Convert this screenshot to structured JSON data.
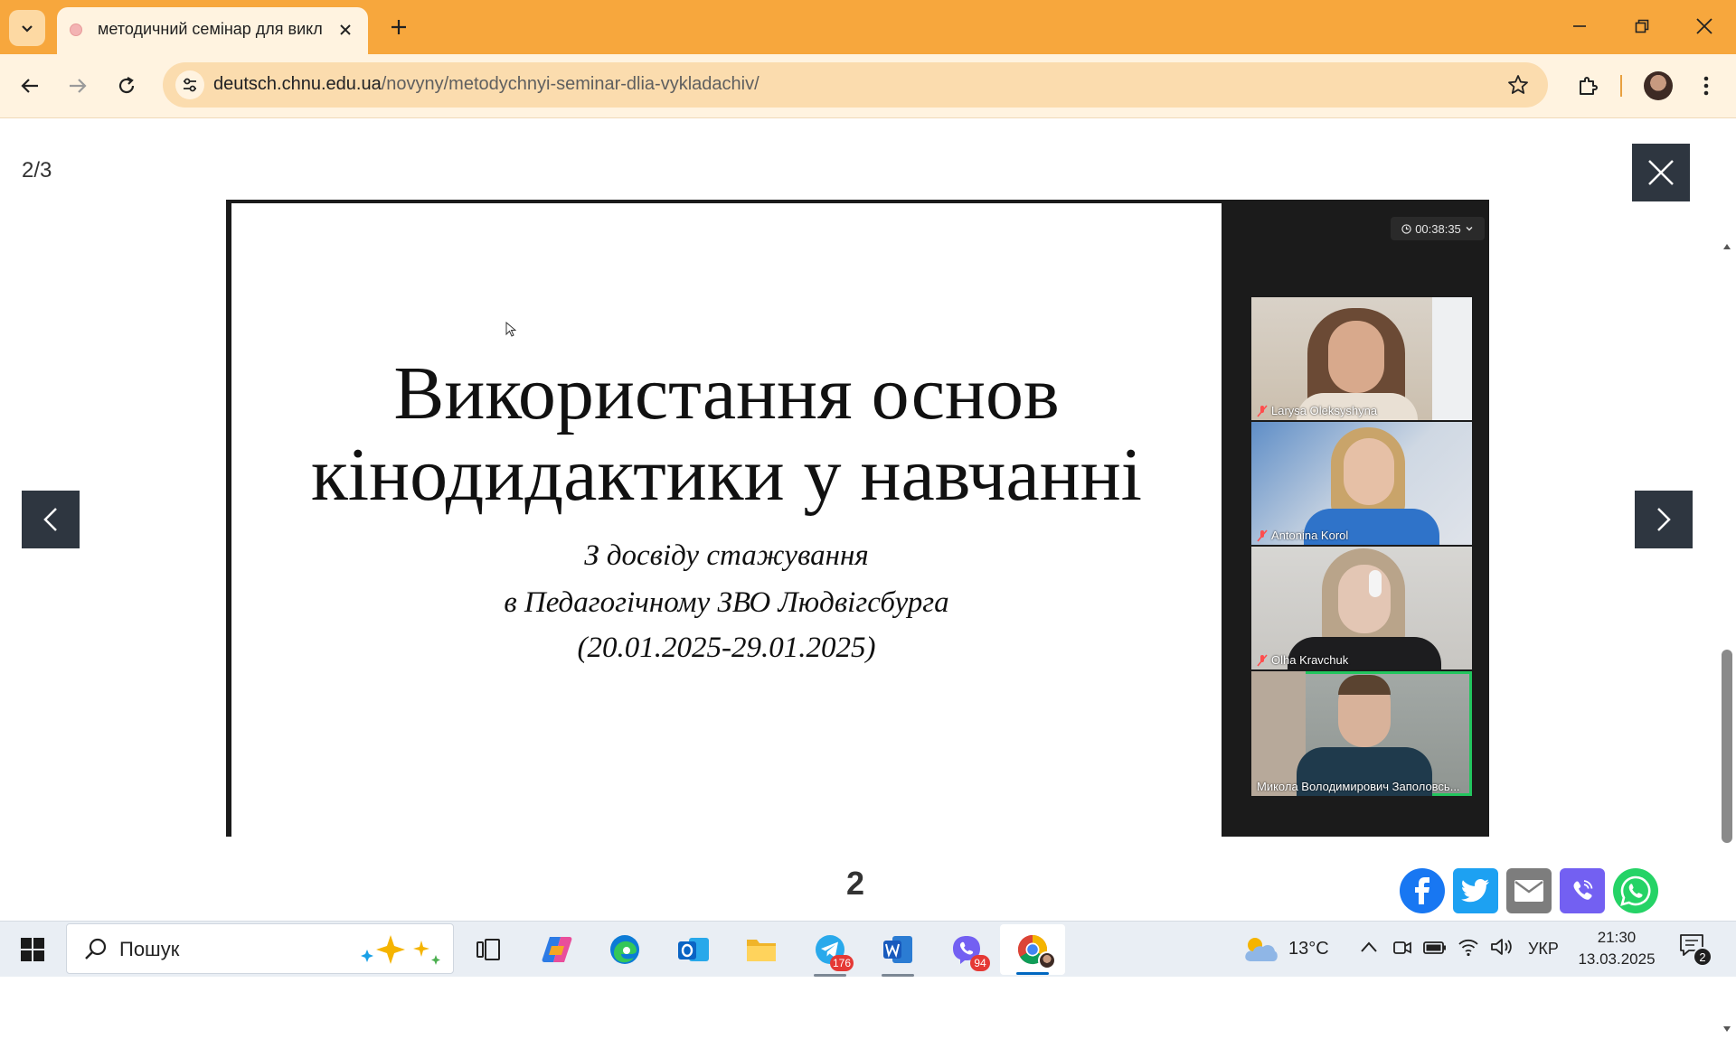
{
  "browser": {
    "tab": {
      "title": "методичний семінар для викл"
    },
    "url": {
      "host": "deutsch.chnu.edu.ua",
      "path": "/novyny/metodychnyi-seminar-dlia-vykladachiv/"
    }
  },
  "lightbox": {
    "counter": "2/3",
    "slide": {
      "title_line1": "Використання основ",
      "title_line2": "кінодидактики у навчанні",
      "subtitle_line1": "З досвіду стажування",
      "subtitle_line2": "в Педагогічному ЗВО Людвігсбурга",
      "subtitle_line3": "(20.01.2025-29.01.2025)"
    },
    "meeting": {
      "timer": "00:38:35",
      "participants": [
        {
          "name": "Larysa Oleksyshyna",
          "muted": true
        },
        {
          "name": "Antonina Korol",
          "muted": true
        },
        {
          "name": "Olha Kravchuk",
          "muted": true
        },
        {
          "name": "Микола Володимирович Заполовсь...",
          "muted": false,
          "speaking": true
        }
      ]
    },
    "page_number": "2"
  },
  "share": [
    {
      "name": "facebook-icon",
      "color": "#1877f2"
    },
    {
      "name": "twitter-icon",
      "color": "#1da1f2"
    },
    {
      "name": "email-icon",
      "color": "#7d7d7d"
    },
    {
      "name": "viber-icon",
      "color": "#7360f2"
    },
    {
      "name": "whatsapp-icon",
      "color": "#25d366"
    }
  ],
  "taskbar": {
    "search_label": "Пошук",
    "telegram_badge": "176",
    "viber_badge": "94",
    "weather": "13°C",
    "language": "УКР",
    "time": "21:30",
    "date": "13.03.2025",
    "notification_count": "2"
  },
  "colors": {
    "tab_strip": "#f7a73d",
    "toolbar": "#fff3e0",
    "lightbox_controls": "#2e3640",
    "speaking_outline": "#22c55e"
  }
}
